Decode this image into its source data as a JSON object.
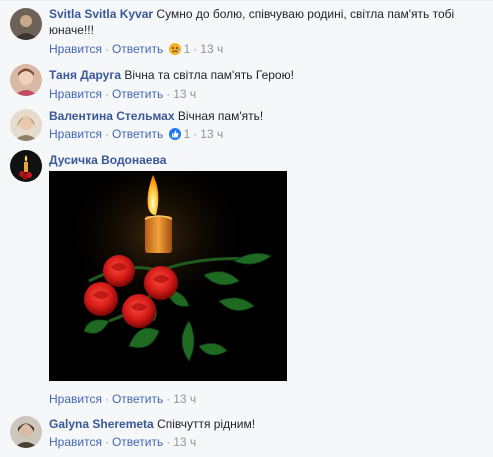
{
  "comments": [
    {
      "name": "Svitla Svitla Kyvar",
      "text": "Сумно до болю, співчуваю родині, світла пам'ять тобі юначе!!!",
      "like": "Нравится",
      "reply": "Ответить",
      "reaction": "sad-reaction",
      "reaction_count": "1",
      "time": "13 ч"
    },
    {
      "name": "Таня Даруга",
      "text": "Вічна та світла пам'ять Герою!",
      "like": "Нравится",
      "reply": "Ответить",
      "time": "13 ч"
    },
    {
      "name": "Валентина Стельмах",
      "text": "Вічная пам'ять!",
      "like": "Нравится",
      "reply": "Ответить",
      "reaction": "like-reaction",
      "reaction_count": "1",
      "time": "13 ч"
    },
    {
      "name": "Дусичка Водонаева",
      "image": "candle-and-roses",
      "like": "Нравится",
      "reply": "Ответить",
      "time": "13 ч"
    },
    {
      "name": "Galyna Sheremeta",
      "text": "Співчуття рідним!",
      "like": "Нравится",
      "reply": "Ответить",
      "time": "13 ч"
    }
  ],
  "separator": "·",
  "colors": {
    "name": "#385898",
    "action": "#4267b2",
    "meta": "#90949c",
    "sad": "#f7b125",
    "like": "#2078f4"
  }
}
